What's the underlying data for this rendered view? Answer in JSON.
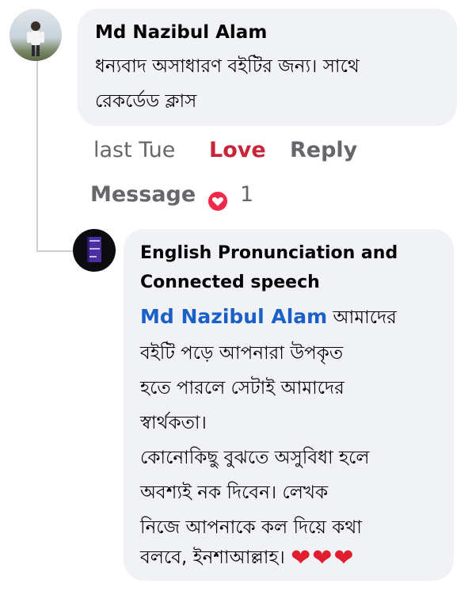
{
  "comment1": {
    "author": "Md Nazibul Alam",
    "lines": [
      "ধন্যবাদ অসাধারণ বইটির জন্য। সাথে",
      "রেকর্ডেড ক্লাস"
    ],
    "time": "last Tue",
    "love_label": "Love",
    "reply_label": "Reply",
    "message_label": "Message",
    "reaction_count": "1"
  },
  "reply1": {
    "author_line1": "English Pronunciation and",
    "author_line2": "Connected speech",
    "mention": "Md Nazibul Alam",
    "first_line_rest": "আমাদের",
    "lines": [
      "বইটি পড়ে আপনারা উপকৃত",
      "হতে পারলে সেটাই আমাদের",
      "স্বার্থকতা।",
      "কোনোকিছু বুঝতে অসুবিধা হলে",
      "অবশ্যই নক দিবেন। লেখক",
      "নিজে  আপনাকে কল দিয়ে কথা",
      "বলবে, ইনশাআল্লাহ।"
    ],
    "hearts": "❤❤❤"
  },
  "colors": {
    "bubble": "#f0f2f5",
    "love": "#c8243a",
    "mention": "#1b5fc8",
    "meta": "#65676b",
    "heart": "#e01e2e"
  },
  "icons": {
    "reaction": "heart-icon",
    "hearts": "red-heart-emoji"
  }
}
